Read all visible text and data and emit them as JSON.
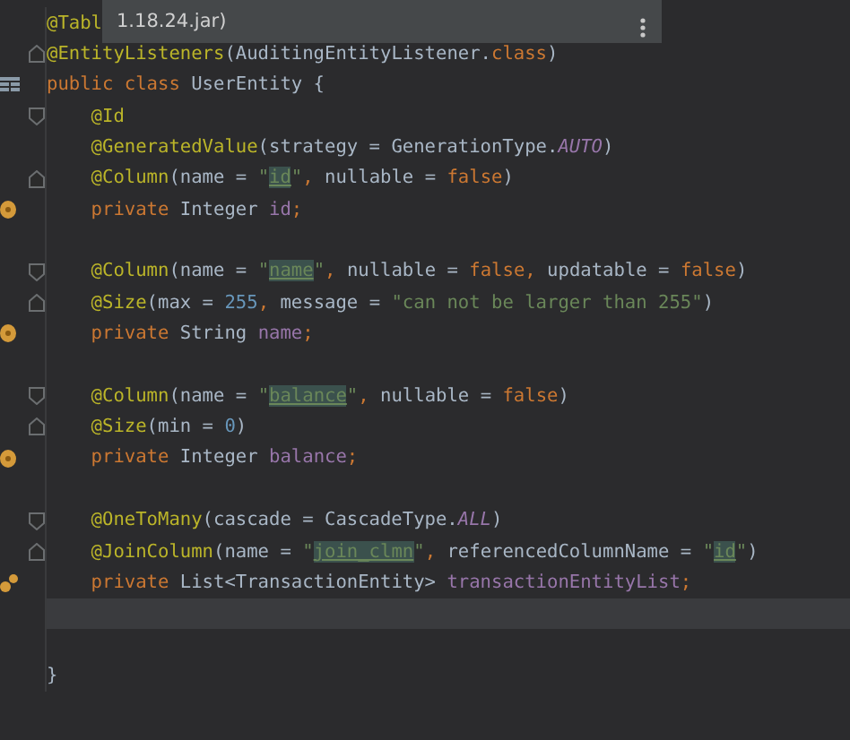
{
  "tooltip": {
    "text": "1.18.24.jar)"
  },
  "lines": [
    {
      "current": false,
      "tokens": [
        {
          "text": "@Tabl",
          "kind": "ann"
        }
      ]
    },
    {
      "current": false,
      "fold": {
        "kind": "end"
      },
      "tokens": [
        {
          "text": "@EntityListeners",
          "kind": "ann"
        },
        {
          "text": "(AuditingEntityListener.",
          "kind": "plain"
        },
        {
          "text": "class",
          "kind": "kw"
        },
        {
          "text": ")",
          "kind": "plain"
        }
      ]
    },
    {
      "current": false,
      "gutter_icon": {
        "kind": "table"
      },
      "tokens": [
        {
          "text": "public class ",
          "kind": "kw"
        },
        {
          "text": "UserEntity {",
          "kind": "plain"
        }
      ],
      "children": [
        {
          "current": false,
          "fold": {
            "kind": "start"
          },
          "tokens": [
            {
              "text": "@Id",
              "kind": "ann"
            }
          ]
        },
        {
          "current": false,
          "tokens": [
            {
              "text": "@GeneratedValue",
              "kind": "ann"
            },
            {
              "text": "(strategy = GenerationType.",
              "kind": "plain"
            },
            {
              "text": "AUTO",
              "kind": "const"
            },
            {
              "text": ")",
              "kind": "plain"
            }
          ]
        },
        {
          "current": false,
          "fold": {
            "kind": "end"
          },
          "tokens": [
            {
              "text": "@Column",
              "kind": "ann"
            },
            {
              "text": "(name = ",
              "kind": "plain"
            },
            {
              "text": "\"",
              "kind": "str"
            },
            {
              "text": "id",
              "kind": "match"
            },
            {
              "text": "\"",
              "kind": "str"
            },
            {
              "text": ", ",
              "kind": "kw"
            },
            {
              "text": "nullable = ",
              "kind": "plain"
            },
            {
              "text": "false",
              "kind": "kw"
            },
            {
              "text": ")",
              "kind": "plain"
            }
          ]
        },
        {
          "current": false,
          "gutter_icon": {
            "kind": "bean"
          },
          "tokens": [
            {
              "text": "private ",
              "kind": "kw"
            },
            {
              "text": "Integer ",
              "kind": "plain"
            },
            {
              "text": "id",
              "kind": "field"
            },
            {
              "text": ";",
              "kind": "kw"
            }
          ]
        },
        {
          "current": false
        },
        {
          "current": false,
          "fold": {
            "kind": "start"
          },
          "tokens": [
            {
              "text": "@Column",
              "kind": "ann"
            },
            {
              "text": "(name = ",
              "kind": "plain"
            },
            {
              "text": "\"",
              "kind": "str"
            },
            {
              "text": "name",
              "kind": "match"
            },
            {
              "text": "\"",
              "kind": "str"
            },
            {
              "text": ", ",
              "kind": "kw"
            },
            {
              "text": "nullable = ",
              "kind": "plain"
            },
            {
              "text": "false",
              "kind": "kw"
            },
            {
              "text": ", ",
              "kind": "kw"
            },
            {
              "text": "updatable = ",
              "kind": "plain"
            },
            {
              "text": "false",
              "kind": "kw"
            },
            {
              "text": ")",
              "kind": "plain"
            }
          ]
        },
        {
          "current": false,
          "fold": {
            "kind": "end"
          },
          "tokens": [
            {
              "text": "@Size",
              "kind": "ann"
            },
            {
              "text": "(max = ",
              "kind": "plain"
            },
            {
              "text": "255",
              "kind": "num"
            },
            {
              "text": ", ",
              "kind": "kw"
            },
            {
              "text": "message = ",
              "kind": "plain"
            },
            {
              "text": "\"can not be larger than 255\"",
              "kind": "str"
            },
            {
              "text": ")",
              "kind": "plain"
            }
          ]
        },
        {
          "current": false,
          "gutter_icon": {
            "kind": "bean"
          },
          "tokens": [
            {
              "text": "private ",
              "kind": "kw"
            },
            {
              "text": "String ",
              "kind": "plain"
            },
            {
              "text": "name",
              "kind": "field"
            },
            {
              "text": ";",
              "kind": "kw"
            }
          ]
        },
        {
          "current": false
        },
        {
          "current": false,
          "fold": {
            "kind": "start"
          },
          "tokens": [
            {
              "text": "@Column",
              "kind": "ann"
            },
            {
              "text": "(name = ",
              "kind": "plain"
            },
            {
              "text": "\"",
              "kind": "str"
            },
            {
              "text": "balance",
              "kind": "match"
            },
            {
              "text": "\"",
              "kind": "str"
            },
            {
              "text": ", ",
              "kind": "kw"
            },
            {
              "text": "nullable = ",
              "kind": "plain"
            },
            {
              "text": "false",
              "kind": "kw"
            },
            {
              "text": ")",
              "kind": "plain"
            }
          ]
        },
        {
          "current": false,
          "fold": {
            "kind": "end"
          },
          "tokens": [
            {
              "text": "@Size",
              "kind": "ann"
            },
            {
              "text": "(min = ",
              "kind": "plain"
            },
            {
              "text": "0",
              "kind": "num"
            },
            {
              "text": ")",
              "kind": "plain"
            }
          ]
        },
        {
          "current": false,
          "gutter_icon": {
            "kind": "bean"
          },
          "tokens": [
            {
              "text": "private ",
              "kind": "kw"
            },
            {
              "text": "Integer ",
              "kind": "plain"
            },
            {
              "text": "balance",
              "kind": "field"
            },
            {
              "text": ";",
              "kind": "kw"
            }
          ]
        },
        {
          "current": false
        },
        {
          "current": false,
          "fold": {
            "kind": "start"
          },
          "tokens": [
            {
              "text": "@OneToMany",
              "kind": "ann"
            },
            {
              "text": "(cascade = CascadeType.",
              "kind": "plain"
            },
            {
              "text": "ALL",
              "kind": "const"
            },
            {
              "text": ")",
              "kind": "plain"
            }
          ]
        },
        {
          "current": false,
          "fold": {
            "kind": "end"
          },
          "tokens": [
            {
              "text": "@JoinColumn",
              "kind": "ann"
            },
            {
              "text": "(name = ",
              "kind": "plain"
            },
            {
              "text": "\"",
              "kind": "str"
            },
            {
              "text": "join_clmn",
              "kind": "match"
            },
            {
              "text": "\"",
              "kind": "str"
            },
            {
              "text": ", ",
              "kind": "kw"
            },
            {
              "text": "referencedColumnName = ",
              "kind": "plain"
            },
            {
              "text": "\"",
              "kind": "str"
            },
            {
              "text": "id",
              "kind": "match"
            },
            {
              "text": "\"",
              "kind": "str"
            },
            {
              "text": ")",
              "kind": "plain"
            }
          ]
        },
        {
          "current": false,
          "gutter_icon": {
            "kind": "beans"
          },
          "tokens": [
            {
              "text": "private ",
              "kind": "kw"
            },
            {
              "text": "List<TransactionEntity> ",
              "kind": "plain"
            },
            {
              "text": "transactionEntityList",
              "kind": "field"
            },
            {
              "text": ";",
              "kind": "kw"
            }
          ]
        },
        {
          "current": true
        },
        {
          "current": false
        }
      ]
    },
    {
      "current": false,
      "tokens": [
        {
          "text": "}",
          "kind": "plain"
        }
      ]
    }
  ]
}
